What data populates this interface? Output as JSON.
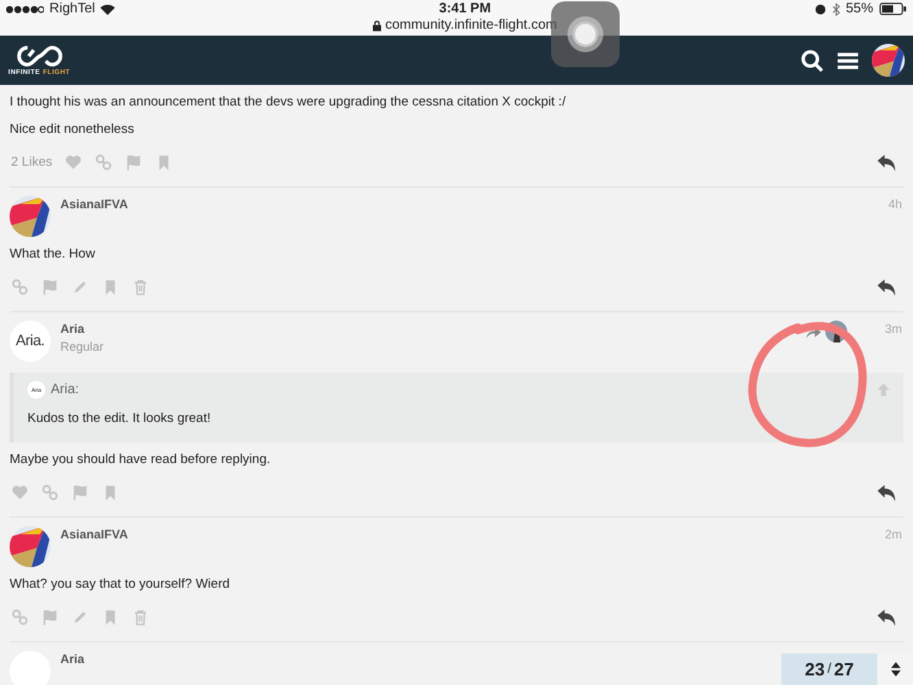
{
  "status_bar": {
    "carrier": "RighTel",
    "time": "3:41 PM",
    "battery": "55%",
    "url": "community.infinite-flight.com"
  },
  "header": {
    "logo_text_1": "INFINITE",
    "logo_text_2": "FLIGHT"
  },
  "posts": [
    {
      "kind": "other",
      "lines": [
        "I thought his was an announcement that the devs were upgrading the cessna citation X cockpit :/",
        "Nice edit nonetheless"
      ],
      "likes": "2 Likes"
    },
    {
      "kind": "own",
      "author": "AsianaIFVA",
      "time": "4h",
      "lines": [
        "What the. How"
      ]
    },
    {
      "kind": "other",
      "author": "Aria",
      "avatar_text": "Aria.",
      "title": "Regular",
      "time": "3m",
      "reply_to": true,
      "quote": {
        "avatar_text": "Aria",
        "author": "Aria:",
        "text": "Kudos to the edit. It looks great!"
      },
      "lines": [
        "Maybe you should have read before replying."
      ]
    },
    {
      "kind": "own",
      "author": "AsianaIFVA",
      "time": "2m",
      "lines": [
        "What? you say that to yourself? Wierd"
      ]
    },
    {
      "kind": "other",
      "author": "Aria"
    }
  ],
  "progress": {
    "current": "23",
    "separator": "/",
    "total": "27"
  },
  "markup": [
    {
      "kind": "circle"
    }
  ]
}
